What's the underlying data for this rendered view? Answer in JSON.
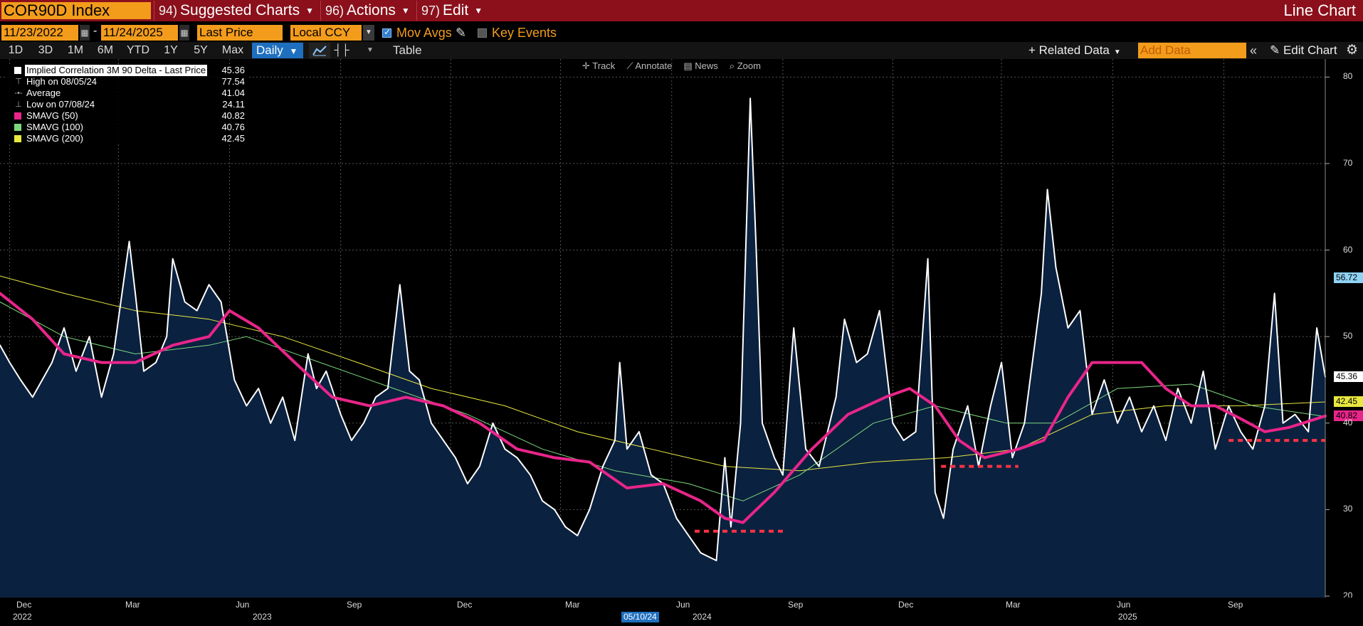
{
  "header": {
    "ticker": "COR90D Index",
    "menus": [
      {
        "num": "94)",
        "label": "Suggested Charts"
      },
      {
        "num": "96)",
        "label": "Actions"
      },
      {
        "num": "97)",
        "label": "Edit"
      }
    ],
    "chart_type": "Line Chart"
  },
  "settings": {
    "start_date": "11/23/2022",
    "end_date": "11/24/2025",
    "field": "Last Price",
    "currency": "Local CCY",
    "mov_avgs_label": "Mov Avgs",
    "key_events_label": "Key Events"
  },
  "toolbar": {
    "ranges": [
      "1D",
      "3D",
      "1M",
      "6M",
      "YTD",
      "1Y",
      "5Y",
      "Max"
    ],
    "frequency": "Daily",
    "table_label": "Table",
    "related_data_label": "Related Data",
    "add_data_placeholder": "Add Data",
    "edit_chart_label": "Edit Chart"
  },
  "chart_tools": [
    "Track",
    "Annotate",
    "News",
    "Zoom"
  ],
  "legend": [
    {
      "label": "Implied Correlation 3M 90 Delta - Last Price",
      "value": "45.36",
      "color": "#ffffff",
      "kind": "swatch"
    },
    {
      "label": "High on 08/05/24",
      "value": "77.54",
      "kind": "high"
    },
    {
      "label": "Average",
      "value": "41.04",
      "kind": "avg"
    },
    {
      "label": "Low on 07/08/24",
      "value": "24.11",
      "kind": "low"
    },
    {
      "label": "SMAVG (50)",
      "value": "40.82",
      "color": "#e8258a",
      "kind": "swatch"
    },
    {
      "label": "SMAVG (100)",
      "value": "40.76",
      "color": "#7dd87d",
      "kind": "swatch"
    },
    {
      "label": "SMAVG (200)",
      "value": "42.45",
      "color": "#e8e840",
      "kind": "swatch"
    }
  ],
  "yaxis_tags": [
    {
      "label": "56.72",
      "value": 56.72,
      "color": "#8fd3f5"
    },
    {
      "label": "45.36",
      "value": 45.36,
      "color": "#ffffff"
    },
    {
      "label": "42.45",
      "value": 42.45,
      "color": "#e8e840"
    },
    {
      "label": "40.82",
      "value": 40.82,
      "color": "#e8258a"
    }
  ],
  "x_months": [
    "Dec",
    "Mar",
    "Jun",
    "Sep",
    "Dec",
    "Mar",
    "Jun",
    "Sep",
    "Dec",
    "Mar",
    "Jun",
    "Sep"
  ],
  "x_years": [
    "2022",
    "2023",
    "2024",
    "2025"
  ],
  "x_cursor": "05/10/24",
  "colors": {
    "accent": "#f39c1c",
    "brand_bar": "#8b101b",
    "area_fill": "#0b2140"
  },
  "chart_data": {
    "type": "line",
    "title": "COR90D Index",
    "ylim": [
      20,
      82
    ],
    "yticks": [
      20,
      30,
      40,
      50,
      60,
      70,
      80
    ],
    "x_range": [
      "2022-11-23",
      "2025-11-24"
    ],
    "grid": true,
    "legend_position": "top-left",
    "series": [
      {
        "name": "Implied Correlation 3M 90 Delta - Last Price",
        "color": "#ffffff",
        "width": 2,
        "fill": true,
        "points": [
          [
            "2022-11-23",
            49
          ],
          [
            "2022-12-01",
            47
          ],
          [
            "2022-12-10",
            45
          ],
          [
            "2022-12-20",
            43
          ],
          [
            "2023-01-05",
            47
          ],
          [
            "2023-01-15",
            51
          ],
          [
            "2023-01-25",
            46
          ],
          [
            "2023-02-05",
            50
          ],
          [
            "2023-02-15",
            43
          ],
          [
            "2023-02-25",
            48
          ],
          [
            "2023-03-05",
            56
          ],
          [
            "2023-03-10",
            61
          ],
          [
            "2023-03-15",
            55
          ],
          [
            "2023-03-22",
            46
          ],
          [
            "2023-04-01",
            47
          ],
          [
            "2023-04-10",
            50
          ],
          [
            "2023-04-15",
            59
          ],
          [
            "2023-04-25",
            54
          ],
          [
            "2023-05-05",
            53
          ],
          [
            "2023-05-15",
            56
          ],
          [
            "2023-05-25",
            54
          ],
          [
            "2023-06-05",
            45
          ],
          [
            "2023-06-15",
            42
          ],
          [
            "2023-06-25",
            44
          ],
          [
            "2023-07-05",
            40
          ],
          [
            "2023-07-15",
            43
          ],
          [
            "2023-07-25",
            38
          ],
          [
            "2023-08-05",
            48
          ],
          [
            "2023-08-12",
            44
          ],
          [
            "2023-08-20",
            46
          ],
          [
            "2023-09-01",
            41
          ],
          [
            "2023-09-10",
            38
          ],
          [
            "2023-09-20",
            40
          ],
          [
            "2023-09-30",
            43
          ],
          [
            "2023-10-10",
            44
          ],
          [
            "2023-10-20",
            56
          ],
          [
            "2023-10-28",
            46
          ],
          [
            "2023-11-05",
            45
          ],
          [
            "2023-11-15",
            40
          ],
          [
            "2023-11-25",
            38
          ],
          [
            "2023-12-05",
            36
          ],
          [
            "2023-12-15",
            33
          ],
          [
            "2023-12-25",
            35
          ],
          [
            "2024-01-05",
            40
          ],
          [
            "2024-01-15",
            37
          ],
          [
            "2024-01-25",
            36
          ],
          [
            "2024-02-05",
            34
          ],
          [
            "2024-02-15",
            31
          ],
          [
            "2024-02-25",
            30
          ],
          [
            "2024-03-05",
            28
          ],
          [
            "2024-03-15",
            27
          ],
          [
            "2024-03-25",
            30
          ],
          [
            "2024-04-05",
            35
          ],
          [
            "2024-04-15",
            38
          ],
          [
            "2024-04-19",
            47
          ],
          [
            "2024-04-25",
            37
          ],
          [
            "2024-05-05",
            39
          ],
          [
            "2024-05-15",
            34
          ],
          [
            "2024-05-25",
            33
          ],
          [
            "2024-06-05",
            29
          ],
          [
            "2024-06-15",
            27
          ],
          [
            "2024-06-25",
            25
          ],
          [
            "2024-07-08",
            24.11
          ],
          [
            "2024-07-15",
            36
          ],
          [
            "2024-07-20",
            28
          ],
          [
            "2024-07-28",
            40
          ],
          [
            "2024-08-05",
            77.54
          ],
          [
            "2024-08-10",
            60
          ],
          [
            "2024-08-15",
            40
          ],
          [
            "2024-08-25",
            36
          ],
          [
            "2024-09-01",
            34
          ],
          [
            "2024-09-10",
            51
          ],
          [
            "2024-09-20",
            37
          ],
          [
            "2024-10-01",
            35
          ],
          [
            "2024-10-15",
            43
          ],
          [
            "2024-10-22",
            52
          ],
          [
            "2024-11-01",
            47
          ],
          [
            "2024-11-10",
            48
          ],
          [
            "2024-11-20",
            53
          ],
          [
            "2024-12-01",
            40
          ],
          [
            "2024-12-10",
            38
          ],
          [
            "2024-12-20",
            39
          ],
          [
            "2024-12-30",
            59
          ],
          [
            "2025-01-05",
            32
          ],
          [
            "2025-01-12",
            29
          ],
          [
            "2025-01-20",
            37
          ],
          [
            "2025-02-01",
            42
          ],
          [
            "2025-02-10",
            35
          ],
          [
            "2025-02-20",
            42
          ],
          [
            "2025-03-01",
            47
          ],
          [
            "2025-03-10",
            36
          ],
          [
            "2025-03-20",
            40
          ],
          [
            "2025-04-03",
            55
          ],
          [
            "2025-04-08",
            67
          ],
          [
            "2025-04-15",
            58
          ],
          [
            "2025-04-25",
            51
          ],
          [
            "2025-05-05",
            53
          ],
          [
            "2025-05-15",
            41
          ],
          [
            "2025-05-25",
            45
          ],
          [
            "2025-06-05",
            40
          ],
          [
            "2025-06-15",
            43
          ],
          [
            "2025-06-25",
            39
          ],
          [
            "2025-07-05",
            42
          ],
          [
            "2025-07-15",
            38
          ],
          [
            "2025-07-25",
            44
          ],
          [
            "2025-08-05",
            40
          ],
          [
            "2025-08-15",
            46
          ],
          [
            "2025-08-25",
            37
          ],
          [
            "2025-09-05",
            42
          ],
          [
            "2025-09-15",
            39
          ],
          [
            "2025-09-25",
            37
          ],
          [
            "2025-10-05",
            42
          ],
          [
            "2025-10-13",
            55
          ],
          [
            "2025-10-20",
            40
          ],
          [
            "2025-10-30",
            41
          ],
          [
            "2025-11-10",
            39
          ],
          [
            "2025-11-17",
            51
          ],
          [
            "2025-11-24",
            45.36
          ]
        ]
      },
      {
        "name": "SMAVG (50)",
        "color": "#e8258a",
        "width": 4,
        "fill": false,
        "points": [
          [
            "2022-11-23",
            55
          ],
          [
            "2022-12-20",
            52
          ],
          [
            "2023-01-15",
            48
          ],
          [
            "2023-02-15",
            47
          ],
          [
            "2023-03-15",
            47
          ],
          [
            "2023-04-15",
            49
          ],
          [
            "2023-05-15",
            50
          ],
          [
            "2023-06-01",
            53
          ],
          [
            "2023-06-25",
            51
          ],
          [
            "2023-07-25",
            47
          ],
          [
            "2023-08-25",
            43
          ],
          [
            "2023-09-25",
            42
          ],
          [
            "2023-10-25",
            43
          ],
          [
            "2023-11-25",
            42
          ],
          [
            "2023-12-25",
            40
          ],
          [
            "2024-01-25",
            37
          ],
          [
            "2024-02-25",
            36
          ],
          [
            "2024-03-25",
            35.5
          ],
          [
            "2024-04-25",
            32.5
          ],
          [
            "2024-05-25",
            33
          ],
          [
            "2024-06-25",
            31
          ],
          [
            "2024-07-15",
            29
          ],
          [
            "2024-07-30",
            28.5
          ],
          [
            "2024-08-25",
            32
          ],
          [
            "2024-09-25",
            37
          ],
          [
            "2024-10-25",
            41
          ],
          [
            "2024-11-25",
            43
          ],
          [
            "2024-12-15",
            44
          ],
          [
            "2025-01-05",
            42
          ],
          [
            "2025-01-25",
            38
          ],
          [
            "2025-02-15",
            36
          ],
          [
            "2025-03-15",
            37
          ],
          [
            "2025-04-05",
            38
          ],
          [
            "2025-04-25",
            43
          ],
          [
            "2025-05-15",
            47
          ],
          [
            "2025-06-05",
            47
          ],
          [
            "2025-06-25",
            47
          ],
          [
            "2025-07-15",
            44
          ],
          [
            "2025-08-05",
            42
          ],
          [
            "2025-08-25",
            42
          ],
          [
            "2025-09-15",
            40.5
          ],
          [
            "2025-10-05",
            39
          ],
          [
            "2025-10-25",
            39.5
          ],
          [
            "2025-11-24",
            40.82
          ]
        ]
      },
      {
        "name": "SMAVG (100)",
        "color": "#7dd87d",
        "width": 1,
        "fill": false,
        "points": [
          [
            "2022-11-23",
            54
          ],
          [
            "2023-01-15",
            50
          ],
          [
            "2023-03-15",
            48
          ],
          [
            "2023-05-15",
            49
          ],
          [
            "2023-06-15",
            50
          ],
          [
            "2023-08-15",
            47
          ],
          [
            "2023-10-15",
            44
          ],
          [
            "2023-12-15",
            41
          ],
          [
            "2024-02-15",
            37
          ],
          [
            "2024-04-15",
            34.5
          ],
          [
            "2024-06-15",
            33
          ],
          [
            "2024-07-30",
            31
          ],
          [
            "2024-09-15",
            34
          ],
          [
            "2024-11-15",
            40
          ],
          [
            "2025-01-05",
            42
          ],
          [
            "2025-03-05",
            40
          ],
          [
            "2025-04-15",
            40
          ],
          [
            "2025-06-05",
            44
          ],
          [
            "2025-08-05",
            44.5
          ],
          [
            "2025-09-25",
            42
          ],
          [
            "2025-11-24",
            40.76
          ]
        ]
      },
      {
        "name": "SMAVG (200)",
        "color": "#e8e840",
        "width": 1,
        "fill": false,
        "points": [
          [
            "2022-11-23",
            57
          ],
          [
            "2023-01-15",
            55
          ],
          [
            "2023-03-15",
            53
          ],
          [
            "2023-05-15",
            52
          ],
          [
            "2023-07-15",
            50
          ],
          [
            "2023-09-15",
            47
          ],
          [
            "2023-11-15",
            44
          ],
          [
            "2024-01-15",
            42
          ],
          [
            "2024-03-15",
            39
          ],
          [
            "2024-05-15",
            37
          ],
          [
            "2024-07-15",
            35
          ],
          [
            "2024-09-15",
            34.5
          ],
          [
            "2024-11-15",
            35.5
          ],
          [
            "2025-01-15",
            36
          ],
          [
            "2025-03-15",
            37
          ],
          [
            "2025-05-15",
            41
          ],
          [
            "2025-07-15",
            42
          ],
          [
            "2025-09-15",
            42
          ],
          [
            "2025-11-24",
            42.45
          ]
        ]
      }
    ],
    "annotations": [
      {
        "type": "dashed-level",
        "color": "#ff3344",
        "y": 27.5,
        "x_from": "2024-06-20",
        "x_to": "2024-09-01"
      },
      {
        "type": "dashed-level",
        "color": "#ff3344",
        "y": 35,
        "x_from": "2025-01-10",
        "x_to": "2025-03-15"
      },
      {
        "type": "dashed-level",
        "color": "#ff3344",
        "y": 38,
        "x_from": "2025-09-05",
        "x_to": "2025-11-24"
      }
    ]
  }
}
